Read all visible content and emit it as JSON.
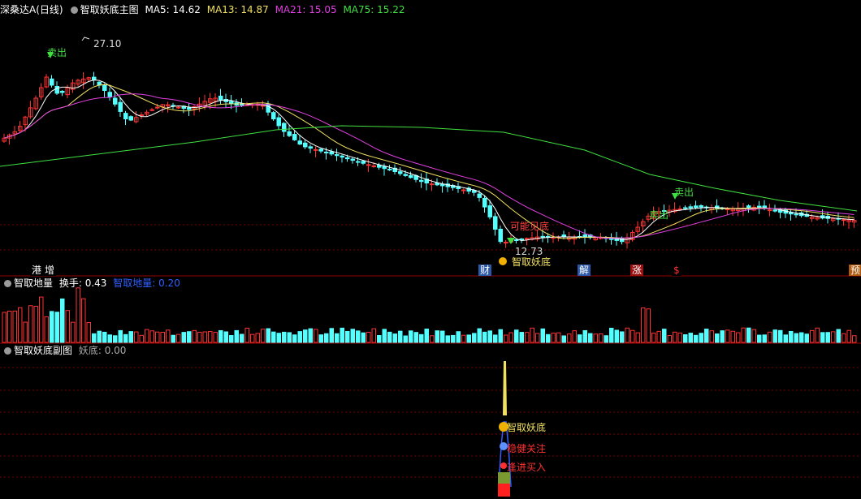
{
  "main_panel": {
    "stock_name": "深桑达A",
    "period": "(日线)",
    "indicator": "智取妖底主图",
    "ma": [
      {
        "label": "MA5: 14.62",
        "color": "#ffffff"
      },
      {
        "label": "MA13: 14.87",
        "color": "#f0e060"
      },
      {
        "label": "MA21: 15.05",
        "color": "#e040e0"
      },
      {
        "label": "MA75: 15.22",
        "color": "#40e040"
      }
    ],
    "high_label": "27.10",
    "low_label": "12.73",
    "sell_label": "卖出",
    "sell_label_2": "卖出",
    "zone_label": "可能见底",
    "yaodi_label": "智取妖底",
    "events": [
      {
        "text": "港",
        "fg": "#ffffff",
        "bg": "#000000"
      },
      {
        "text": "增",
        "fg": "#ffffff",
        "bg": "#000000"
      },
      {
        "text": "财",
        "fg": "#ffffff",
        "bg": "#2d5aa8"
      },
      {
        "text": "解",
        "fg": "#ffffff",
        "bg": "#2d5aa8"
      },
      {
        "text": "涨",
        "fg": "#ffffff",
        "bg": "#9a1010"
      },
      {
        "text": "$",
        "fg": "#ff3030",
        "bg": "#000000"
      },
      {
        "text": "预",
        "fg": "#ffffff",
        "bg": "#b05a10"
      }
    ]
  },
  "volume_panel": {
    "indicator": "智取地量",
    "turnover": "换手: 0.43",
    "series": "智取地量: 0.20"
  },
  "sub_panel": {
    "indicator": "智取妖底副图",
    "series": "妖底: 0.00",
    "labels": [
      "智取妖底",
      "稳健关注",
      "逢进买入"
    ]
  },
  "colors": {
    "up": "#ff3232",
    "down": "#54ffff",
    "grid": "#7a0000",
    "separator": "#9a0000",
    "ma5": "#ffffff",
    "ma13": "#f0e060",
    "ma21": "#e040e0",
    "ma75": "#40e040",
    "sell": "#40e040",
    "bottom_arrow": "#40e040"
  }
}
